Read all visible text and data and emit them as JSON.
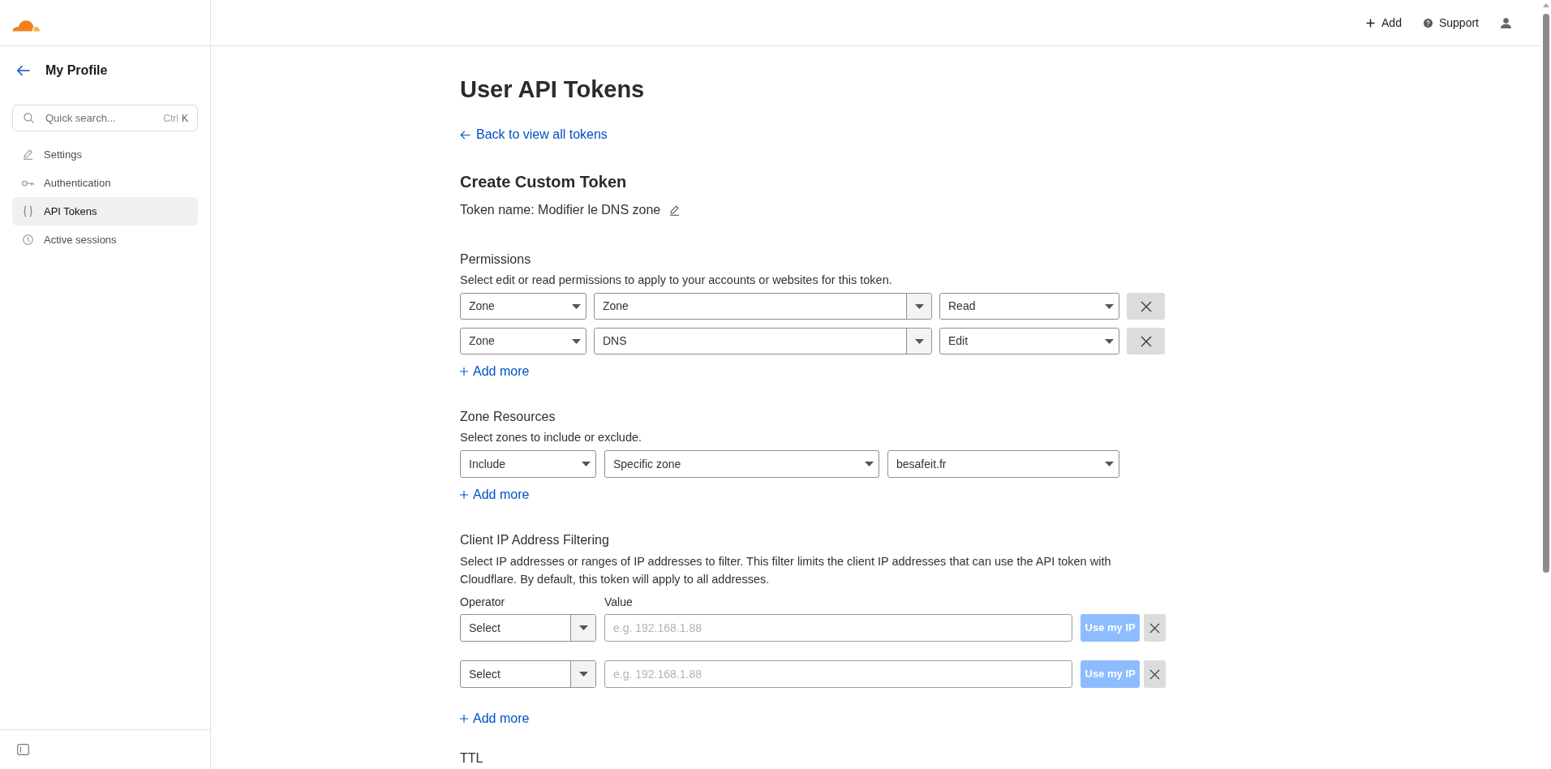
{
  "header": {
    "actions": [
      {
        "kind": "add",
        "label": "Add"
      },
      {
        "kind": "support",
        "label": "Support"
      },
      {
        "kind": "user"
      }
    ]
  },
  "sidebar": {
    "title": "My Profile",
    "search": {
      "placeholder": "Quick search...",
      "shortcut": [
        "Ctrl",
        "K"
      ]
    },
    "items": [
      {
        "kind": "pencil",
        "label": "Settings",
        "selected": false
      },
      {
        "kind": "key",
        "label": "Authentication",
        "selected": false
      },
      {
        "kind": "braces",
        "label": "API Tokens",
        "selected": true
      },
      {
        "kind": "clock",
        "label": "Active sessions",
        "selected": false
      }
    ]
  },
  "page": {
    "title": "User API Tokens",
    "back_link": "Back to view all tokens"
  },
  "form": {
    "title": "Create Custom Token",
    "token_name": "Token name: Modifier le DNS zone",
    "permissions": {
      "title": "Permissions",
      "description": "Select edit or read permissions to apply to your accounts or websites for this token.",
      "rows": [
        {
          "type": "Zone",
          "group": "Zone",
          "access": "Read"
        },
        {
          "type": "Zone",
          "group": "DNS",
          "access": "Edit"
        }
      ],
      "add_more": "Add more"
    },
    "zone_resources": {
      "title": "Zone Resources",
      "description": "Select zones to include or exclude.",
      "rows": [
        {
          "mode": "Include",
          "scope": "Specific zone",
          "zone": "besafeit.fr"
        }
      ],
      "add_more": "Add more"
    },
    "ip_filtering": {
      "title": "Client IP Address Filtering",
      "description": "Select IP addresses or ranges of IP addresses to filter. This filter limits the client IP addresses that can use the API token with Cloudflare. By default, this token will apply to all addresses.",
      "operator_label": "Operator",
      "value_label": "Value",
      "rows": [
        {
          "operator": "Select",
          "placeholder": "e.g. 192.168.1.88",
          "button": "Use my IP",
          "disabled": true
        },
        {
          "operator": "Select",
          "placeholder": "e.g. 192.168.1.88",
          "button": "Use my IP",
          "disabled": true
        }
      ],
      "add_more": "Add more"
    },
    "ttl": {
      "title": "TTL"
    }
  }
}
